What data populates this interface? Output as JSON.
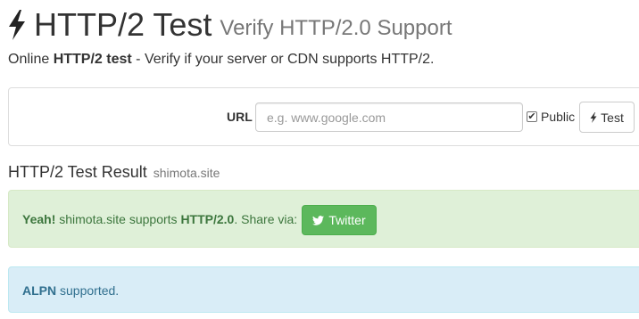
{
  "header": {
    "title": "HTTP/2 Test",
    "subtitle": "Verify HTTP/2.0 Support"
  },
  "intro": {
    "prefix": "Online ",
    "bold": "HTTP/2 test",
    "suffix": " - Verify if your server or CDN supports HTTP/2."
  },
  "form": {
    "url_label": "URL",
    "url_placeholder": "e.g. www.google.com",
    "url_value": "",
    "public_label": "Public",
    "public_checked": true,
    "test_button_label": "Test"
  },
  "result": {
    "heading": "HTTP/2 Test Result",
    "domain": "shimota.site"
  },
  "success_alert": {
    "yeah": "Yeah!",
    "domain": "shimota.site",
    "supports_text": " supports ",
    "protocol": "HTTP/2.0",
    "share_text": ". Share via:",
    "twitter_label": "Twitter"
  },
  "info_alert": {
    "alpn": "ALPN",
    "supported_text": " supported."
  },
  "colors": {
    "success_bg": "#dff0d8",
    "success_text": "#3c763d",
    "twitter_button": "#5cb85c",
    "info_bg": "#d9edf7",
    "info_text": "#31708f"
  },
  "icons": {
    "title_icon": "bolt-icon",
    "test_icon": "bolt-icon",
    "twitter_icon": "twitter-icon"
  }
}
